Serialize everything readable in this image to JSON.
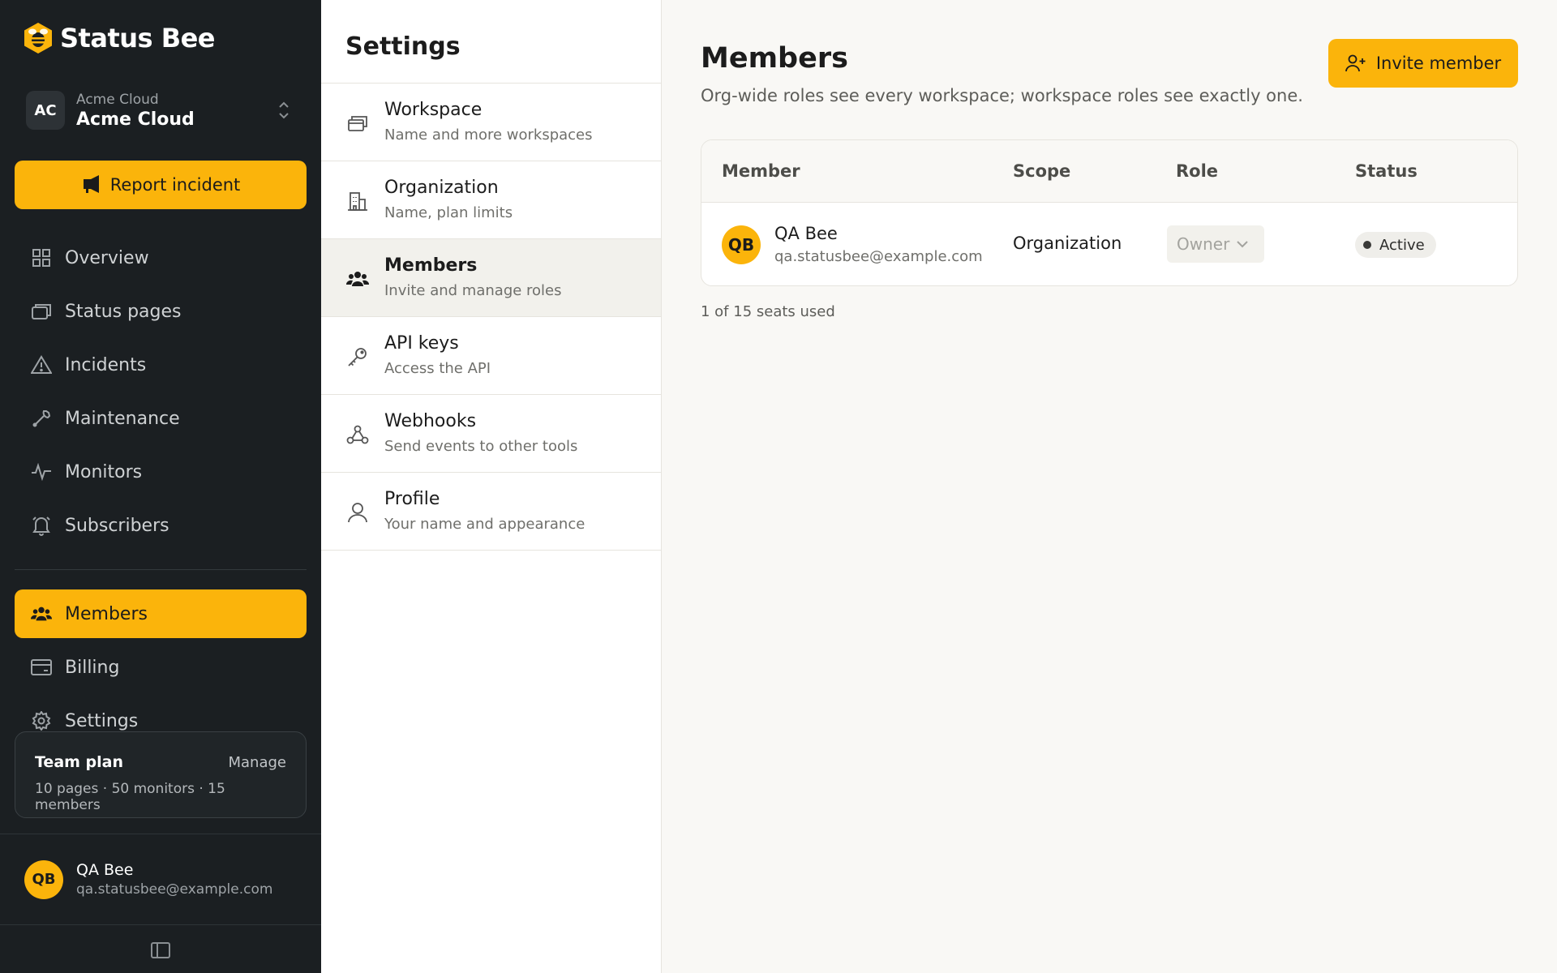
{
  "brand": {
    "name": "Status Bee"
  },
  "workspace": {
    "initials": "AC",
    "org": "Acme Cloud",
    "name": "Acme Cloud"
  },
  "report_button": {
    "label": "Report incident"
  },
  "nav": {
    "overview": "Overview",
    "status_pages": "Status pages",
    "incidents": "Incidents",
    "maintenance": "Maintenance",
    "monitors": "Monitors",
    "subscribers": "Subscribers",
    "members": "Members",
    "billing": "Billing",
    "settings": "Settings"
  },
  "plan": {
    "name": "Team plan",
    "manage": "Manage",
    "desc": "10 pages · 50 monitors · 15 members"
  },
  "user": {
    "initials": "QB",
    "name": "QA Bee",
    "email": "qa.statusbee@example.com"
  },
  "settings": {
    "title": "Settings",
    "items": [
      {
        "label": "Workspace",
        "sub": "Name and more workspaces"
      },
      {
        "label": "Organization",
        "sub": "Name, plan limits"
      },
      {
        "label": "Members",
        "sub": "Invite and manage roles"
      },
      {
        "label": "API keys",
        "sub": "Access the API"
      },
      {
        "label": "Webhooks",
        "sub": "Send events to other tools"
      },
      {
        "label": "Profile",
        "sub": "Your name and appearance"
      }
    ]
  },
  "main": {
    "title": "Members",
    "subtitle": "Org-wide roles see every workspace; workspace roles see exactly one.",
    "invite": "Invite member",
    "columns": [
      "Member",
      "Scope",
      "Role",
      "Status"
    ],
    "rows": [
      {
        "initials": "QB",
        "name": "QA Bee",
        "email": "qa.statusbee@example.com",
        "scope": "Organization",
        "role": "Owner",
        "status": "Active"
      }
    ],
    "seats": "1 of 15 seats used"
  },
  "colors": {
    "accent": "#fbb40b",
    "sidebar_bg": "#1b1f22",
    "main_bg": "#f9f8f5"
  }
}
